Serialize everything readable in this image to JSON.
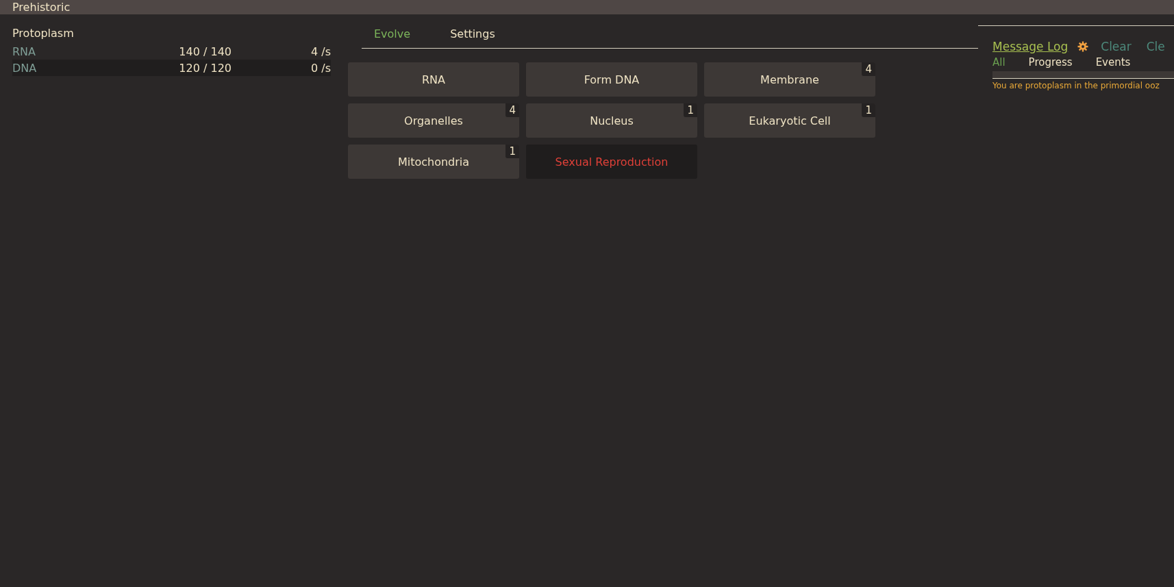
{
  "window": {
    "title": "Prehistoric"
  },
  "resources": {
    "group": "Protoplasm",
    "rows": [
      {
        "name": "RNA",
        "amount": "140 / 140",
        "rate": "4 /s"
      },
      {
        "name": "DNA",
        "amount": "120 / 120",
        "rate": "0 /s"
      }
    ]
  },
  "tabs": [
    {
      "label": "Evolve",
      "selected": true
    },
    {
      "label": "Settings",
      "selected": false
    }
  ],
  "actions": [
    {
      "label": "RNA",
      "affordable": true
    },
    {
      "label": "Form DNA",
      "affordable": true
    },
    {
      "label": "Membrane",
      "count": "4",
      "affordable": true
    },
    {
      "label": "Organelles",
      "count": "4",
      "affordable": true
    },
    {
      "label": "Nucleus",
      "count": "1",
      "affordable": true
    },
    {
      "label": "Eukaryotic Cell",
      "count": "1",
      "affordable": true
    },
    {
      "label": "Mitochondria",
      "count": "1",
      "affordable": true
    },
    {
      "label": "Sexual Reproduction",
      "affordable": false
    }
  ],
  "message_log": {
    "title": "Message Log",
    "buttons": [
      "Clear",
      "Cle"
    ],
    "filters": [
      {
        "label": "All",
        "selected": true
      },
      {
        "label": "Progress",
        "selected": false
      },
      {
        "label": "Events",
        "selected": false
      }
    ],
    "messages": [
      "You are protoplasm in the primordial ooz"
    ]
  }
}
